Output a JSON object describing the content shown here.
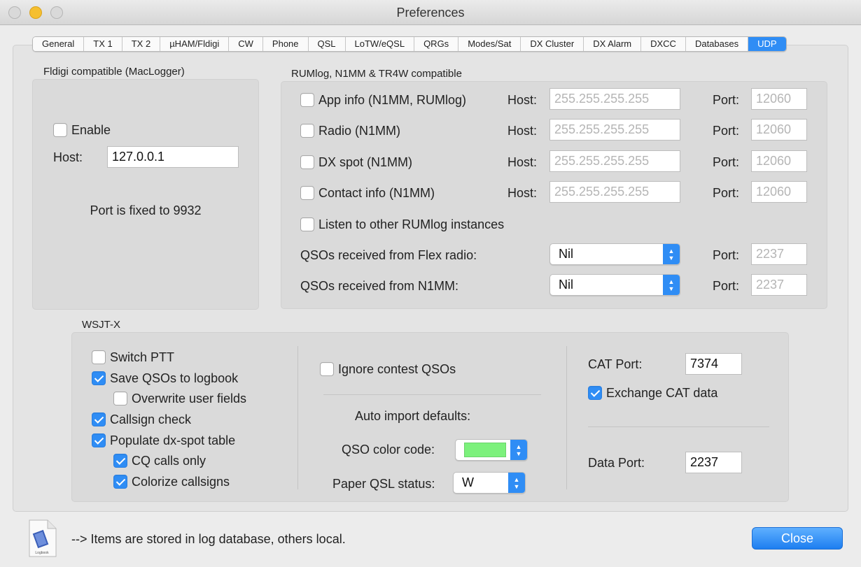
{
  "window": {
    "title": "Preferences"
  },
  "tabs": [
    "General",
    "TX 1",
    "TX 2",
    "µHAM/Fldigi",
    "CW",
    "Phone",
    "QSL",
    "LoTW/eQSL",
    "QRGs",
    "Modes/Sat",
    "DX Cluster",
    "DX Alarm",
    "DXCC",
    "Databases",
    "UDP"
  ],
  "active_tab": "UDP",
  "fldigi": {
    "title": "Fldigi compatible (MacLogger)",
    "enable_label": "Enable",
    "host_label": "Host:",
    "host_value": "127.0.0.1",
    "port_note": "Port is fixed to 9932"
  },
  "rumlog": {
    "title": "RUMlog, N1MM & TR4W compatible",
    "host_label": "Host:",
    "port_label": "Port:",
    "rows": [
      {
        "label": "App info (N1MM, RUMlog)",
        "host": "255.255.255.255",
        "port": "12060"
      },
      {
        "label": "Radio (N1MM)",
        "host": "255.255.255.255",
        "port": "12060"
      },
      {
        "label": "DX spot (N1MM)",
        "host": "255.255.255.255",
        "port": "12060"
      },
      {
        "label": "Contact info (N1MM)",
        "host": "255.255.255.255",
        "port": "12060"
      }
    ],
    "listen_label": "Listen to other RUMlog instances",
    "flex_label": "QSOs received from Flex radio:",
    "flex_value": "Nil",
    "flex_port": "2237",
    "n1mm_label": "QSOs received from N1MM:",
    "n1mm_value": "Nil",
    "n1mm_port": "2237"
  },
  "wsjtx": {
    "title": "WSJT-X",
    "switch_ptt": "Switch PTT",
    "save_qsos": "Save QSOs to logbook",
    "overwrite": "Overwrite user fields",
    "callsign_check": "Callsign check",
    "populate": "Populate dx-spot table",
    "cq_only": "CQ calls only",
    "colorize": "Colorize callsigns",
    "ignore_contest": "Ignore contest QSOs",
    "auto_import": "Auto import defaults:",
    "color_code_label": "QSO color code:",
    "color_code_value": "#7cf17c",
    "paper_qsl_label": "Paper QSL status:",
    "paper_qsl_value": "W",
    "cat_port_label": "CAT Port:",
    "cat_port_value": "7374",
    "exchange_cat": "Exchange CAT data",
    "data_port_label": "Data Port:",
    "data_port_value": "2237"
  },
  "footer": {
    "note": "--> Items are stored in log database, others local.",
    "icon_text": "Logbook",
    "close_label": "Close"
  },
  "colors": {
    "accent": "#2f8df5",
    "swatch": "#7cf17c"
  }
}
